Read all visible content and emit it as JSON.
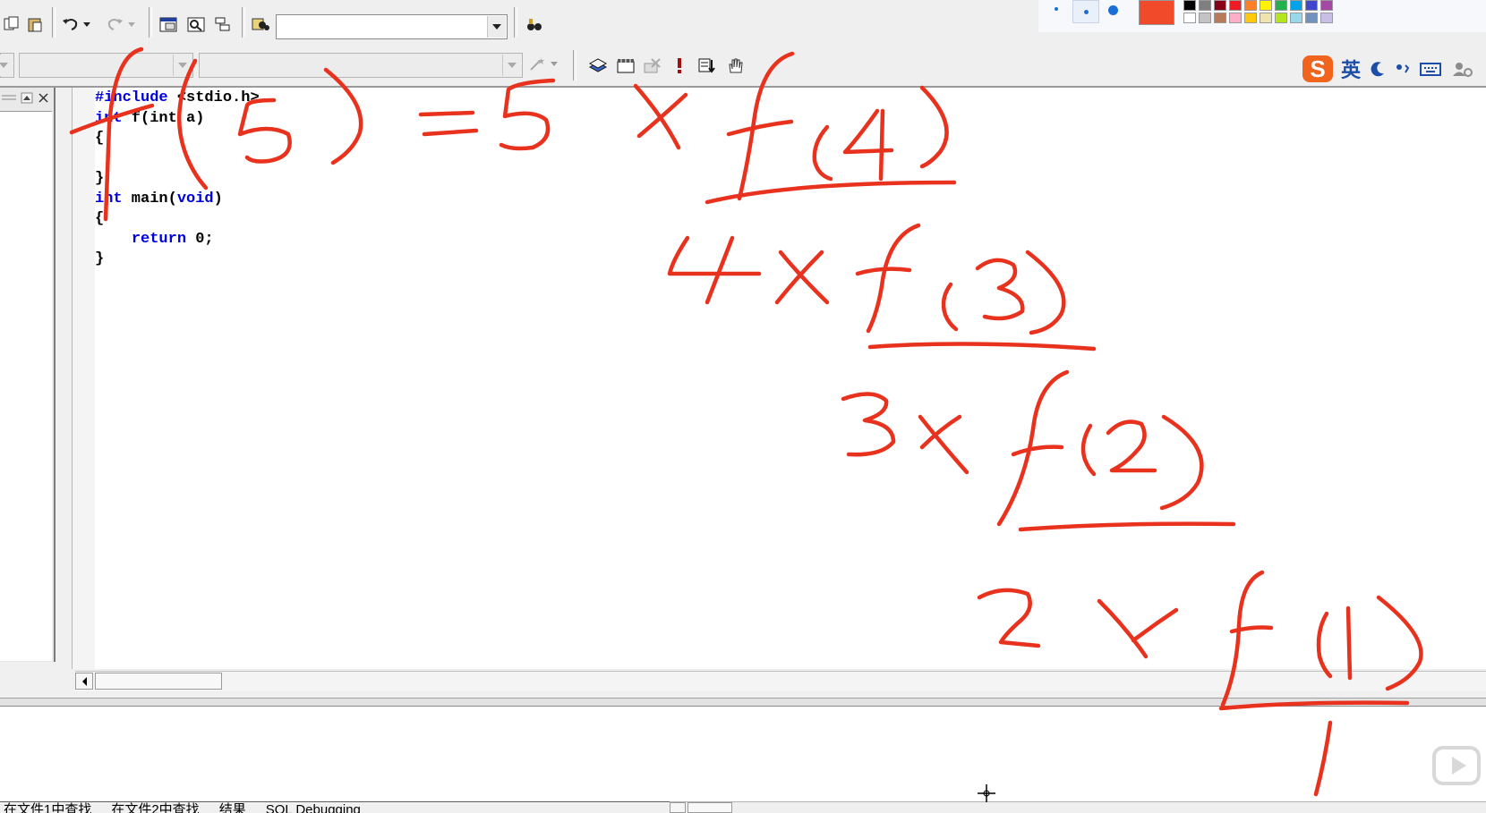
{
  "toolbar": {
    "combo_file_value": "",
    "combo_class_value": "",
    "combo_member_value": ""
  },
  "ime": {
    "mode_label": "英"
  },
  "code": {
    "l1": {
      "kw": "#include",
      "rest": " <stdio.h>"
    },
    "l2": {
      "kw": "int",
      "rest": " f(int a)"
    },
    "l3": "{",
    "l4": "",
    "l5": "}",
    "l6": {
      "kw": "int",
      "mid": " main(",
      "kw2": "void",
      "rest": ")"
    },
    "l7": "{",
    "l8": {
      "indent": "    ",
      "kw": "return",
      "rest": " 0;"
    },
    "l9": "}"
  },
  "output_tabs": [
    "在文件1中查找",
    "在文件2中查找",
    "结果",
    "SQL Debugging"
  ],
  "annotation": {
    "color": "#e8321e",
    "line1": "f(5) = 5 × f(4)",
    "line2": "4 × f(3)",
    "line3": "3 × f(2)",
    "line4": "2 × f(1)",
    "line5": "1"
  },
  "palette": [
    "#000000",
    "#7f7f7f",
    "#880015",
    "#ed1c24",
    "#ff7f27",
    "#fff200",
    "#22b14c",
    "#00a2e8",
    "#3f48cc",
    "#a349a4",
    "#ffffff",
    "#c3c3c3",
    "#b97a57",
    "#ffaec9",
    "#ffc90e",
    "#efe4b0",
    "#b5e61d",
    "#99d9ea",
    "#7092be",
    "#c8bfe7"
  ]
}
